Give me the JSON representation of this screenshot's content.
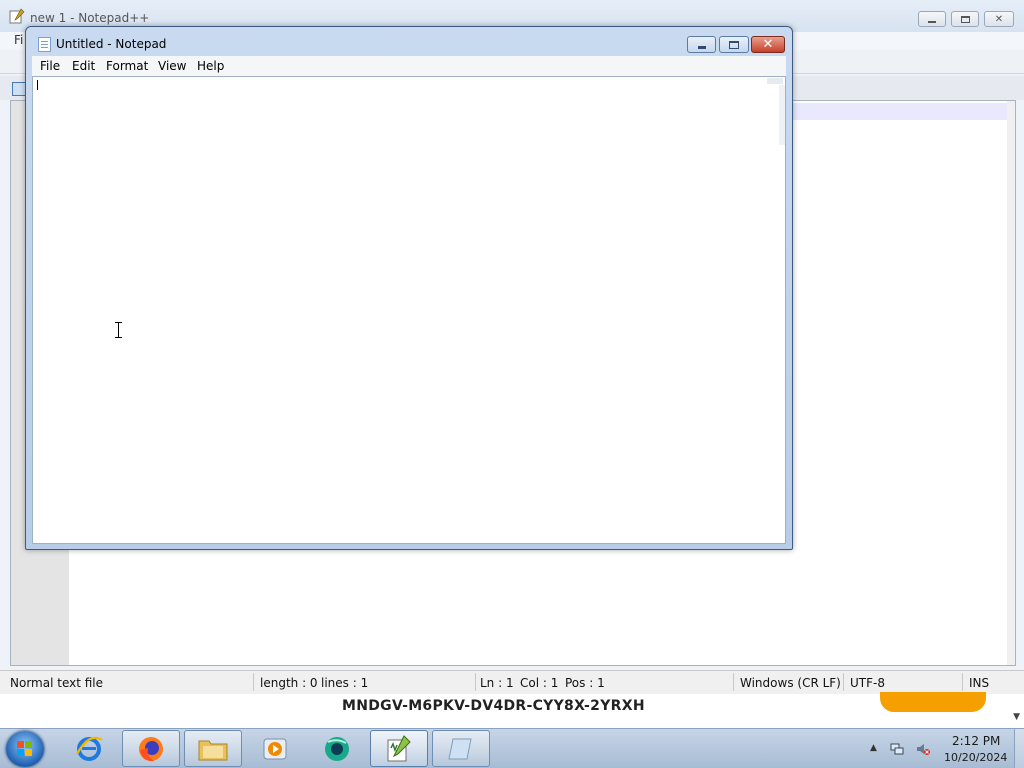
{
  "npp": {
    "title": "new 1 - Notepad++",
    "menu_stub": "Fi",
    "status": {
      "file_type": "Normal text file",
      "length": "length : 0",
      "lines": "lines : 1",
      "ln": "Ln : 1",
      "col": "Col : 1",
      "pos": "Pos : 1",
      "eol": "Windows (CR LF)",
      "encoding": "UTF-8",
      "mode": "INS"
    }
  },
  "notepad": {
    "title": "Untitled - Notepad",
    "menu": [
      "File",
      "Edit",
      "Format",
      "View",
      "Help"
    ],
    "content": ""
  },
  "banner": {
    "key": "MNDGV-M6PKV-DV4DR-CYY8X-2YRXH"
  },
  "taskbar": {
    "items": [
      {
        "name": "internet-explorer",
        "icon": "ie-icon"
      },
      {
        "name": "firefox",
        "icon": "firefox-icon"
      },
      {
        "name": "file-explorer",
        "icon": "folder-icon"
      },
      {
        "name": "media-player",
        "icon": "media-player-icon"
      },
      {
        "name": "app-green",
        "icon": "green-app-icon"
      },
      {
        "name": "notepadpp",
        "icon": "notepadpp-icon"
      },
      {
        "name": "notepad",
        "icon": "notepad-icon"
      }
    ],
    "clock_time": "2:12 PM",
    "clock_date": "10/20/2024"
  },
  "colors": {
    "taskbar": "#a7bcd4",
    "banner_accent": "#f5a000",
    "close_button": "#c7402a"
  }
}
